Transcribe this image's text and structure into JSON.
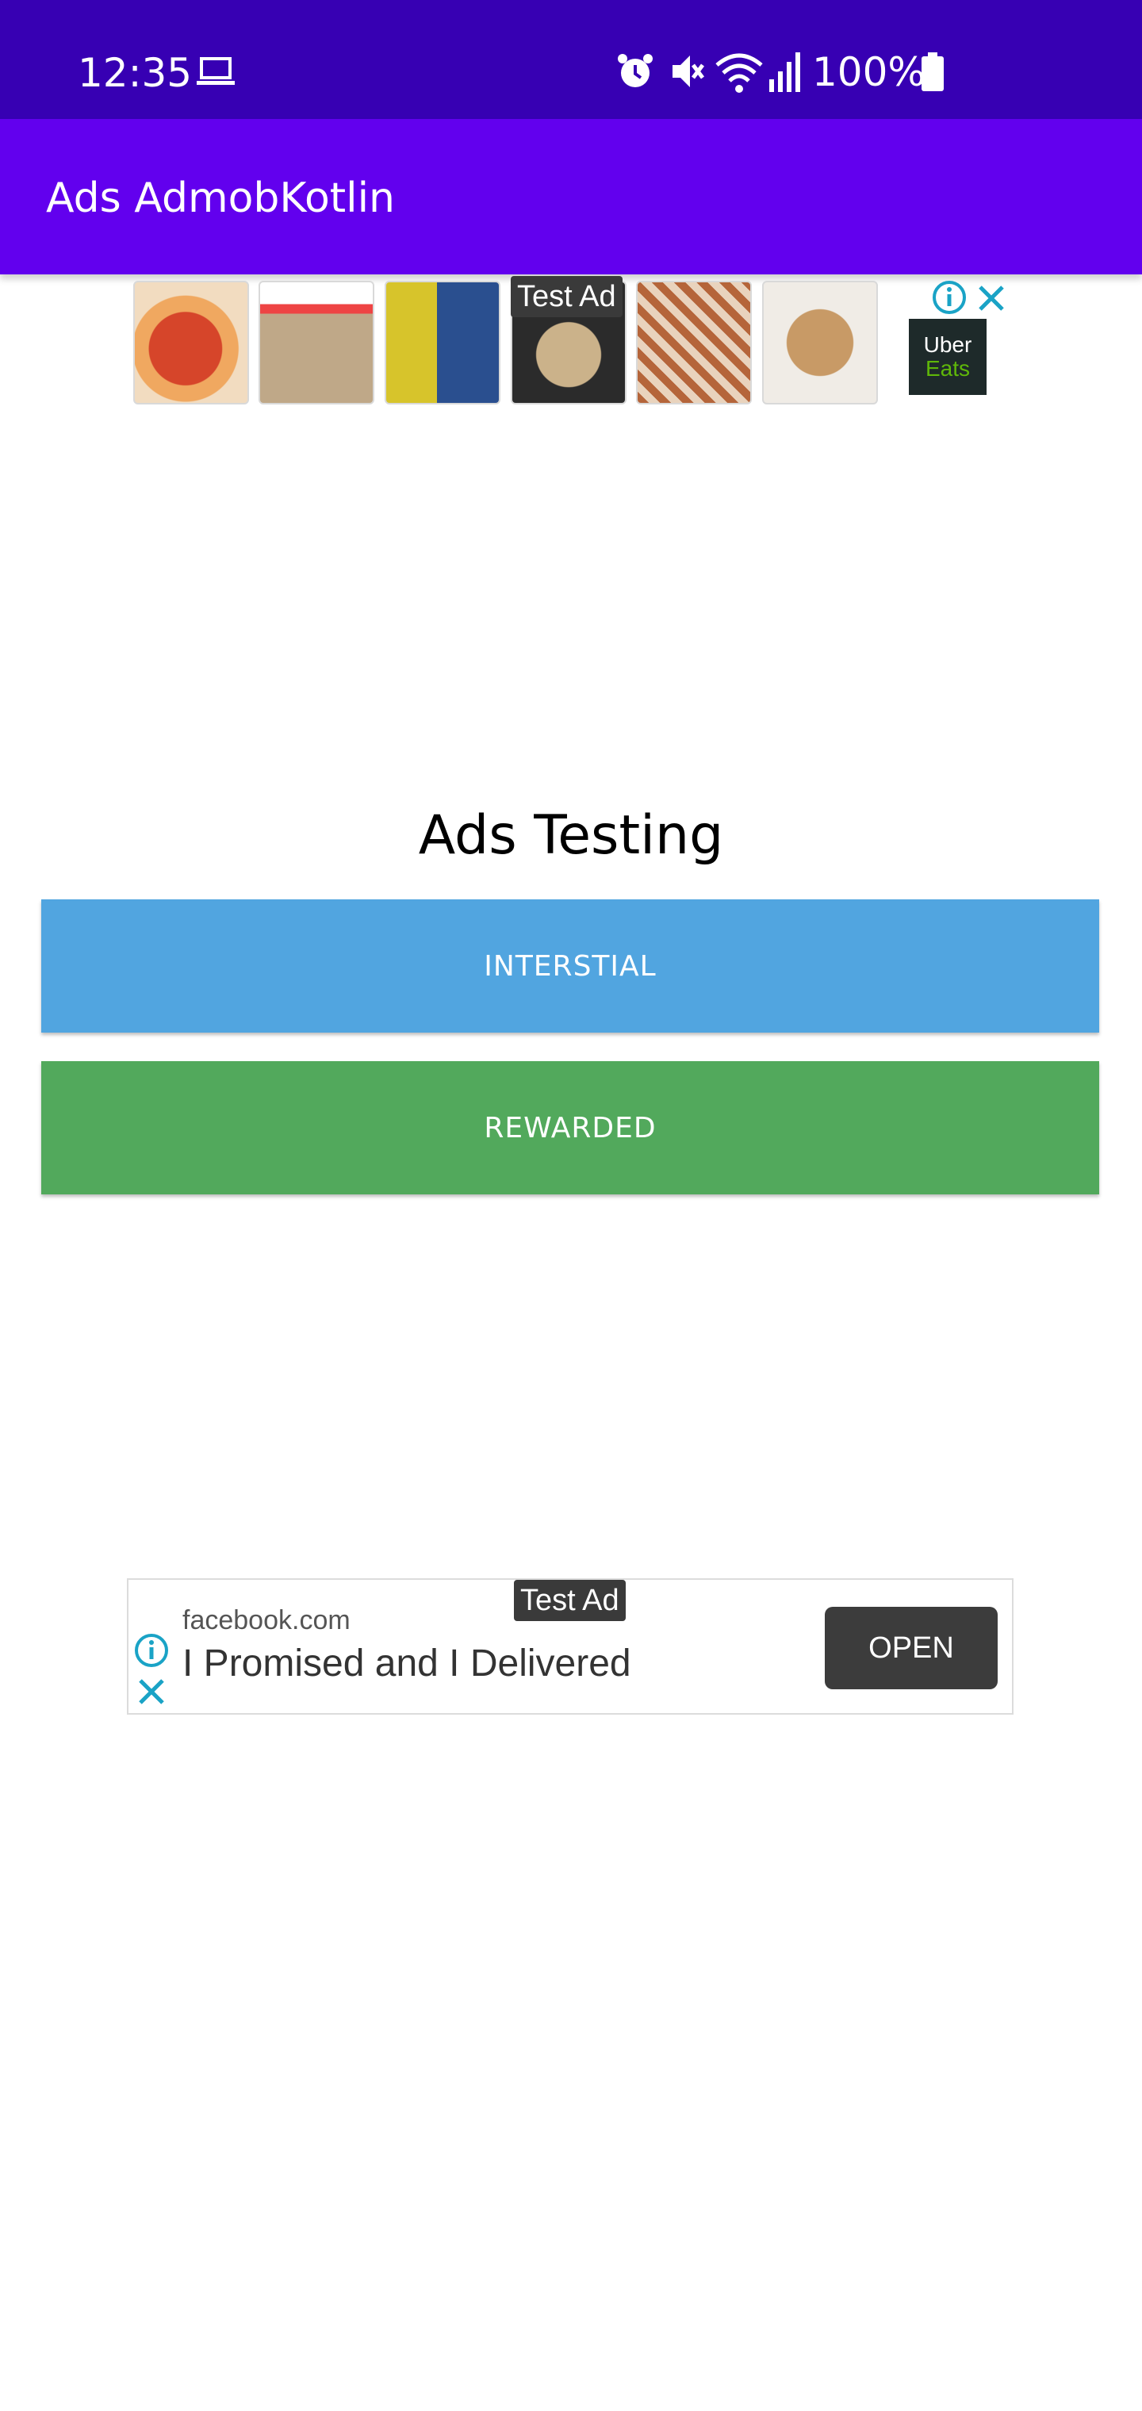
{
  "status_bar": {
    "time": "12:35",
    "battery": "100%",
    "icons": [
      "laptop-icon",
      "alarm-icon",
      "vibrate-mute-icon",
      "wifi-icon",
      "signal-icon",
      "battery-icon"
    ]
  },
  "app_bar": {
    "title": "Ads AdmobKotlin",
    "color": "#6200ee"
  },
  "top_ad": {
    "badge": "Test Ad",
    "brand_line1": "Uber",
    "brand_line2": "Eats",
    "icons": [
      "ad-info-icon",
      "ad-close-icon"
    ]
  },
  "main": {
    "heading": "Ads Testing",
    "interstitial_label": "INTERSTIAL",
    "rewarded_label": "REWARDED",
    "interstitial_color": "#51a5e0",
    "rewarded_color": "#52a95c"
  },
  "bottom_ad": {
    "badge": "Test Ad",
    "domain": "facebook.com",
    "headline": "I Promised and I Delivered",
    "cta": "OPEN"
  }
}
